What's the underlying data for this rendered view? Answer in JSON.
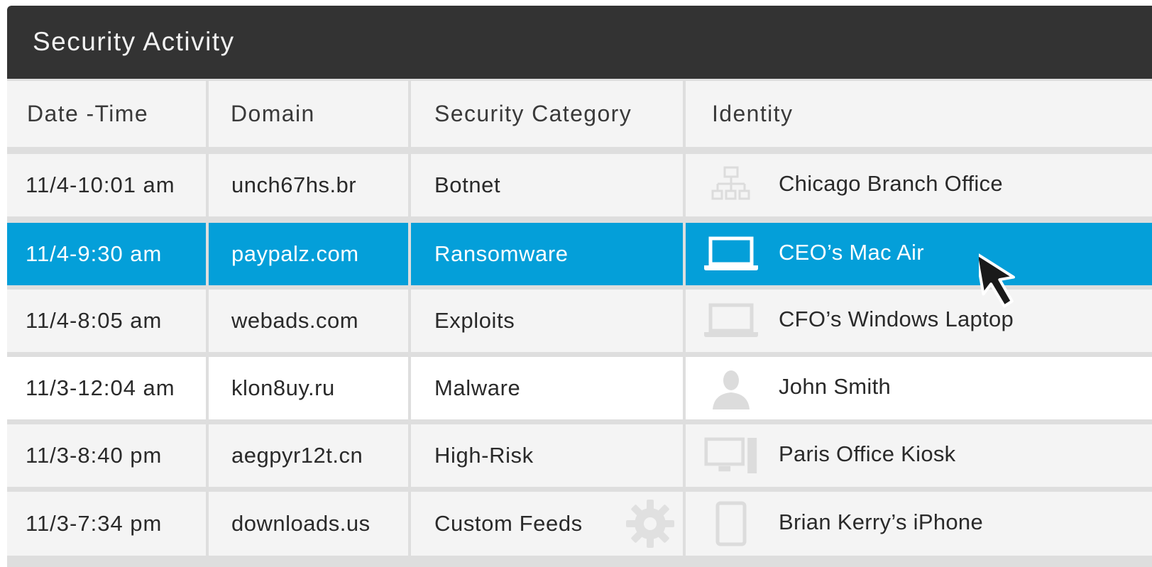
{
  "panel": {
    "title": "Security Activity"
  },
  "columns": [
    "Date -Time",
    "Domain",
    "Security Category",
    "Identity"
  ],
  "rows": [
    {
      "datetime": "11/4-10:01 am",
      "domain": "unch67hs.br",
      "category": "Botnet",
      "identity": "Chicago Branch Office",
      "identity_icon": "network-icon",
      "style": "gray"
    },
    {
      "datetime": "11/4-9:30 am",
      "domain": "paypalz.com",
      "category": "Ransomware",
      "identity": "CEO’s Mac Air",
      "identity_icon": "laptop-icon",
      "style": "selected"
    },
    {
      "datetime": "11/4-8:05 am",
      "domain": "webads.com",
      "category": "Exploits",
      "identity": "CFO’s Windows Laptop",
      "identity_icon": "laptop-icon",
      "style": "gray"
    },
    {
      "datetime": "11/3-12:04 am",
      "domain": "klon8uy.ru",
      "category": "Malware",
      "identity": "John Smith",
      "identity_icon": "user-icon",
      "style": "white"
    },
    {
      "datetime": "11/3-8:40 pm",
      "domain": "aegpyr12t.cn",
      "category": "High-Risk",
      "identity": "Paris Office Kiosk",
      "identity_icon": "kiosk-icon",
      "style": "gray"
    },
    {
      "datetime": "11/3-7:34 pm",
      "domain": "downloads.us",
      "category": "Custom Feeds",
      "identity": "Brian Kerry’s iPhone",
      "identity_icon": "phone-icon",
      "style": "gray",
      "category_icon": "gear-icon"
    }
  ],
  "colors": {
    "header_bg": "#333333",
    "selected_bg": "#049fd9",
    "row_bg": "#f4f4f4",
    "divider": "#dedede"
  }
}
